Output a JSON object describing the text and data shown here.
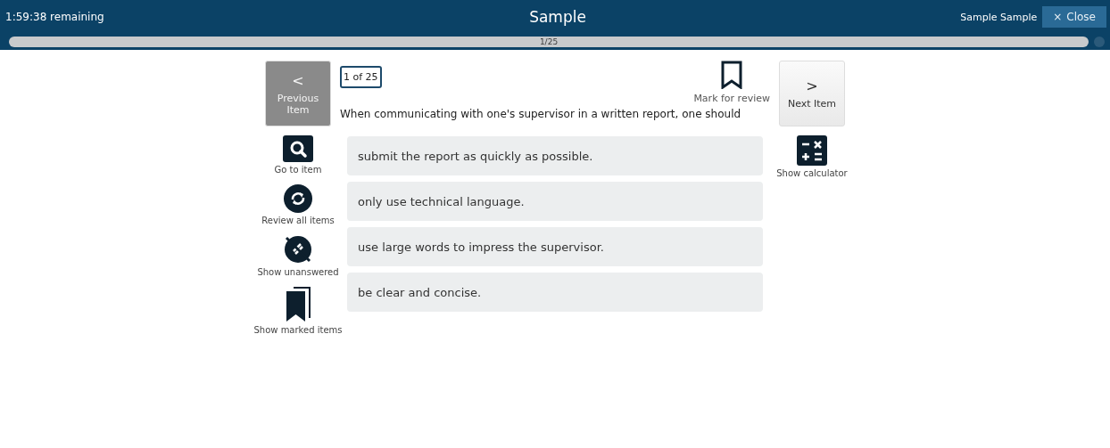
{
  "header": {
    "timer": "1:59:38 remaining",
    "title": "Sample",
    "user": "Sample Sample",
    "close_button": {
      "icon": "×",
      "label": "Close"
    }
  },
  "progress": {
    "label": "1/25"
  },
  "nav": {
    "previous": {
      "icon": "<",
      "label": "Previous Item",
      "disabled": true
    },
    "next": {
      "icon": ">",
      "label": "Next Item",
      "disabled": false
    }
  },
  "tools": [
    {
      "kind": "search",
      "label": "Go to item"
    },
    {
      "kind": "review",
      "label": "Review all items"
    },
    {
      "kind": "unanswered",
      "label": "Show unanswered"
    },
    {
      "kind": "marked",
      "label": "Show marked items"
    }
  ],
  "question": {
    "counter": "1 of 25",
    "mark_for_review": {
      "label": "Mark for review",
      "marked": false
    },
    "stem": "When communicating with one's supervisor in a written report, one should"
  },
  "options": [
    {
      "text": "submit the report as quickly as possible.",
      "selected": false
    },
    {
      "text": "only use technical language.",
      "selected": false
    },
    {
      "text": "use large words to impress the supervisor.",
      "selected": false
    },
    {
      "text": "be clear and concise.",
      "selected": false
    }
  ],
  "calculator": {
    "label": "Show calculator"
  }
}
